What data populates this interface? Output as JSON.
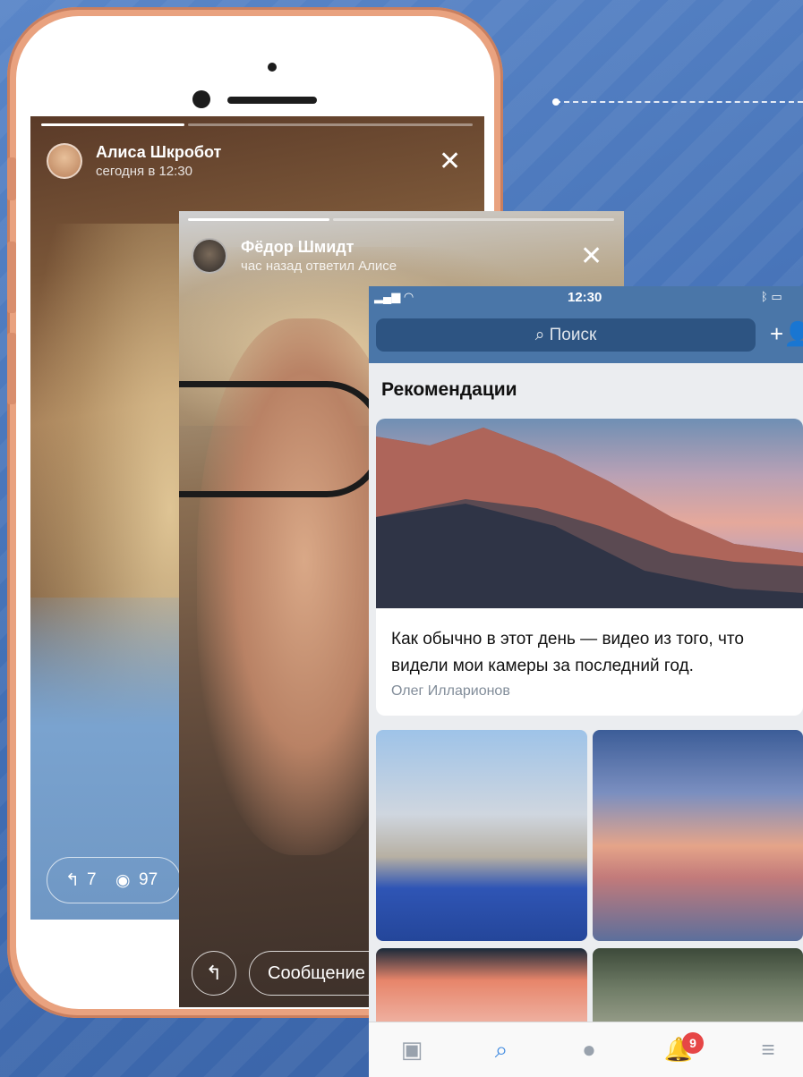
{
  "story_alisa": {
    "name": "Алиса Шкробот",
    "time": "сегодня в 12:30",
    "replies": "7",
    "views": "97"
  },
  "story_fedor": {
    "name": "Фёдор Шмидт",
    "subtitle": "час назад ответил Алисе",
    "message_placeholder": "Сообщение"
  },
  "app": {
    "status_time": "12:30",
    "search_placeholder": "Поиск",
    "section_title": "Рекомендации",
    "card_text": "Как обычно в этот день — видео из того, что видели мои камеры за последний год.",
    "card_author": "Олег Илларионов",
    "notifications_count": "9"
  },
  "colors": {
    "vk_blue": "#4a76a8",
    "badge_red": "#e64646",
    "phone_gold": "#e9a27f"
  }
}
